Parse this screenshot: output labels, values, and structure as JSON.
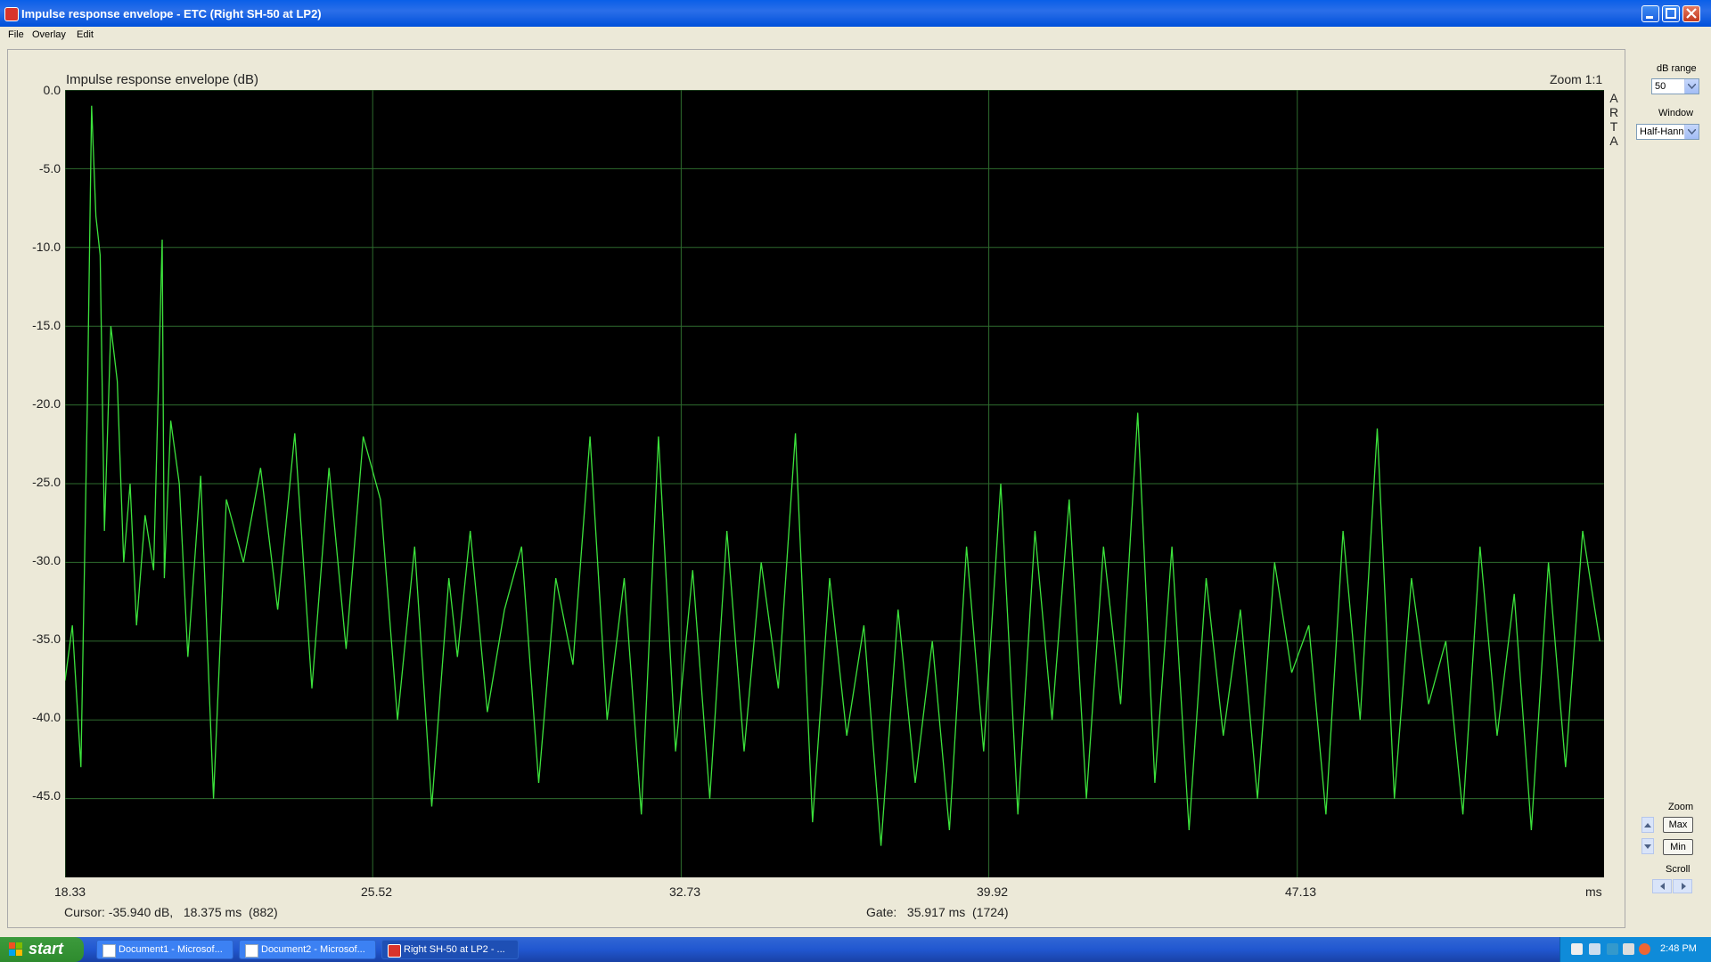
{
  "window": {
    "title": "Impulse response envelope - ETC (Right SH-50 at LP2)"
  },
  "menu": [
    "File",
    "Overlay",
    "Edit"
  ],
  "plot": {
    "title": "Impulse response envelope (dB)",
    "zoom_ratio": "Zoom 1:1",
    "side_label": "ARTA",
    "cursor_readout": "Cursor: -35.940 dB,   18.375 ms  (882)",
    "gate_readout": "Gate:   35.917 ms  (1724)"
  },
  "controls": {
    "db_range_label": "dB range",
    "db_range_value": "50",
    "window_label": "Window",
    "window_value": "Half-Hann",
    "zoom_label": "Zoom",
    "zoom_max": "Max",
    "zoom_min": "Min",
    "scroll_label": "Scroll"
  },
  "taskbar": {
    "start": "start",
    "tasks": [
      "Document1 - Microsof...",
      "Document2 - Microsof...",
      "Right SH-50 at LP2 - ..."
    ],
    "clock": "2:48 PM"
  },
  "colors": {
    "trace": "#3CE23C",
    "grid": "#2E6B2E",
    "plot_bg": "#000000",
    "titlebar": "#0A5FE8"
  },
  "chart_data": {
    "type": "line",
    "title": "Impulse response envelope (dB)",
    "xlabel": "ms",
    "ylabel": "",
    "x_ticks": [
      "18.33",
      "25.52",
      "32.73",
      "39.92",
      "47.13"
    ],
    "y_ticks": [
      "0.0",
      "-5.0",
      "-10.0",
      "-15.0",
      "-20.0",
      "-25.0",
      "-30.0",
      "-35.0",
      "-40.0",
      "-45.0"
    ],
    "xlim": [
      18.33,
      54.3
    ],
    "ylim": [
      -50,
      0
    ],
    "grid": true,
    "series": [
      {
        "x": [
          18.33,
          18.5,
          18.7,
          18.85,
          18.95,
          19.05,
          19.15,
          19.25,
          19.4,
          19.55,
          19.7,
          19.85,
          20.0,
          20.2,
          20.4,
          20.6,
          20.65,
          20.8,
          21.0,
          21.2,
          21.5,
          21.8,
          22.1,
          22.5,
          22.9,
          23.3,
          23.7,
          24.1,
          24.5,
          24.9,
          25.3,
          25.7,
          26.1,
          26.5,
          26.9,
          27.3,
          27.5,
          27.8,
          28.2,
          28.6,
          29.0,
          29.4,
          29.8,
          30.2,
          30.6,
          31.0,
          31.4,
          31.8,
          32.2,
          32.6,
          33.0,
          33.4,
          33.8,
          34.2,
          34.6,
          35.0,
          35.4,
          35.8,
          36.2,
          36.6,
          37.0,
          37.4,
          37.8,
          38.2,
          38.6,
          39.0,
          39.4,
          39.8,
          40.2,
          40.6,
          41.0,
          41.4,
          41.8,
          42.2,
          42.6,
          43.0,
          43.4,
          43.8,
          44.2,
          44.6,
          45.0,
          45.4,
          45.8,
          46.2,
          46.6,
          47.0,
          47.4,
          47.8,
          48.2,
          48.6,
          49.0,
          49.4,
          49.8,
          50.2,
          50.6,
          51.0,
          51.4,
          51.8,
          52.2,
          52.6,
          53.0,
          53.4,
          53.8,
          54.2
        ],
        "y": [
          -37.5,
          -34.0,
          -43.0,
          -20.0,
          -1.0,
          -8.0,
          -10.5,
          -28.0,
          -15.0,
          -18.5,
          -30.0,
          -25.0,
          -34.0,
          -27.0,
          -30.5,
          -9.5,
          -31.0,
          -21.0,
          -25.0,
          -36.0,
          -24.5,
          -45.0,
          -26.0,
          -30.0,
          -24.0,
          -33.0,
          -21.8,
          -38.0,
          -24.0,
          -35.5,
          -22.0,
          -26.0,
          -40.0,
          -29.0,
          -45.5,
          -31.0,
          -36.0,
          -28.0,
          -39.5,
          -33.0,
          -29.0,
          -44.0,
          -31.0,
          -36.5,
          -22.0,
          -40.0,
          -31.0,
          -46.0,
          -22.0,
          -42.0,
          -30.5,
          -45.0,
          -28.0,
          -42.0,
          -30.0,
          -38.0,
          -21.8,
          -46.5,
          -31.0,
          -41.0,
          -34.0,
          -48.0,
          -33.0,
          -44.0,
          -35.0,
          -47.0,
          -29.0,
          -42.0,
          -25.0,
          -46.0,
          -28.0,
          -40.0,
          -26.0,
          -45.0,
          -29.0,
          -39.0,
          -20.5,
          -44.0,
          -29.0,
          -47.0,
          -31.0,
          -41.0,
          -33.0,
          -45.0,
          -30.0,
          -37.0,
          -34.0,
          -46.0,
          -28.0,
          -40.0,
          -21.5,
          -45.0,
          -31.0,
          -39.0,
          -35.0,
          -46.0,
          -29.0,
          -41.0,
          -32.0,
          -47.0,
          -30.0,
          -43.0,
          -28.0,
          -35.0
        ]
      }
    ]
  }
}
